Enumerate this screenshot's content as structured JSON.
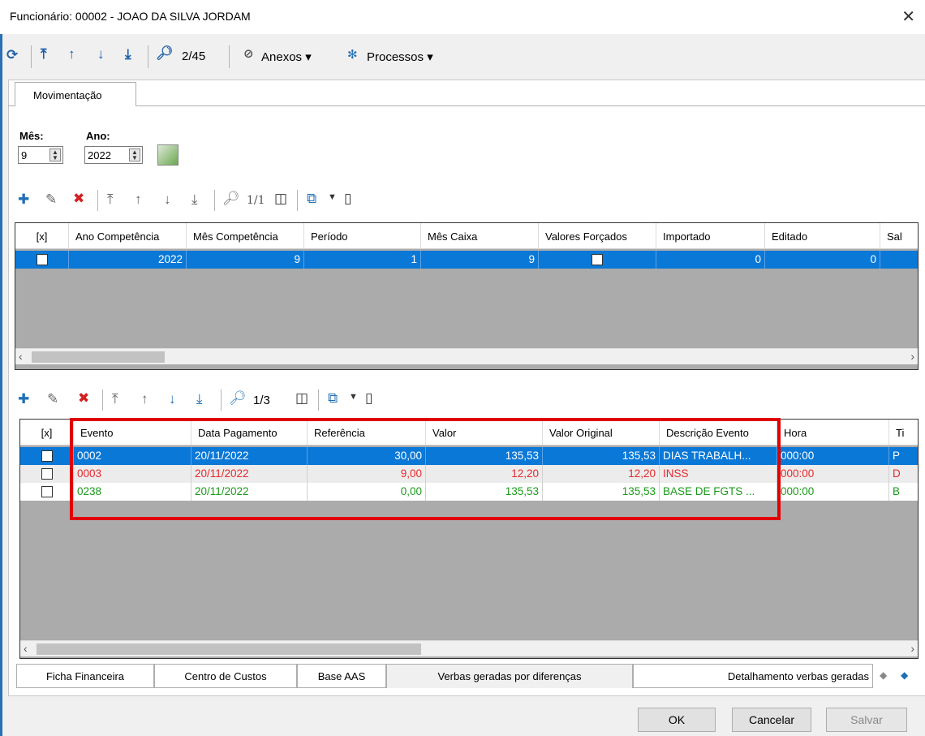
{
  "window": {
    "title": "Funcionário: 00002 - JOAO DA SILVA JORDAM"
  },
  "toolbar": {
    "counter": "2/45",
    "anexos": "Anexos",
    "processos": "Processos"
  },
  "tabs": {
    "movimentacao": "Movimentação"
  },
  "filters": {
    "mes_label": "Mês:",
    "mes_value": "9",
    "ano_label": "Ano:",
    "ano_value": "2022"
  },
  "grid1": {
    "counter": "1/1",
    "columns": [
      "[x]",
      "Ano Competência",
      "Mês Competência",
      "Período",
      "Mês Caixa",
      "Valores Forçados",
      "Importado",
      "Editado",
      "Sal"
    ],
    "rows": [
      {
        "ano": "2022",
        "mes": "9",
        "periodo": "1",
        "mes_caixa": "9",
        "importado": "0",
        "editado": "0"
      }
    ]
  },
  "grid2": {
    "counter": "1/3",
    "columns": [
      "[x]",
      "Evento",
      "Data Pagamento",
      "Referência",
      "Valor",
      "Valor Original",
      "Descrição Evento",
      "Hora",
      "Ti"
    ],
    "rows": [
      {
        "evento": "0002",
        "data": "20/11/2022",
        "referencia": "30,00",
        "valor": "135,53",
        "valor_original": "135,53",
        "descricao": "DIAS TRABALH...",
        "hora": "000:00",
        "tipo": "P",
        "color": "#ffffff"
      },
      {
        "evento": "0003",
        "data": "20/11/2022",
        "referencia": "9,00",
        "valor": "12,20",
        "valor_original": "12,20",
        "descricao": "INSS",
        "hora": "000:00",
        "tipo": "D",
        "color": "#e8282b"
      },
      {
        "evento": "0238",
        "data": "20/11/2022",
        "referencia": "0,00",
        "valor": "135,53",
        "valor_original": "135,53",
        "descricao": "BASE DE FGTS ...",
        "hora": "000:00",
        "tipo": "B",
        "color": "#1a9a1a"
      }
    ]
  },
  "bottom_tabs": [
    "Ficha Financeira",
    "Centro de Custos",
    "Base AAS",
    "Verbas geradas por diferenças",
    "Detalhamento verbas geradas"
  ],
  "buttons": {
    "ok": "OK",
    "cancelar": "Cancelar",
    "salvar": "Salvar"
  },
  "colors": {
    "selection": "#0a78d7",
    "highlight": "#e10000"
  }
}
